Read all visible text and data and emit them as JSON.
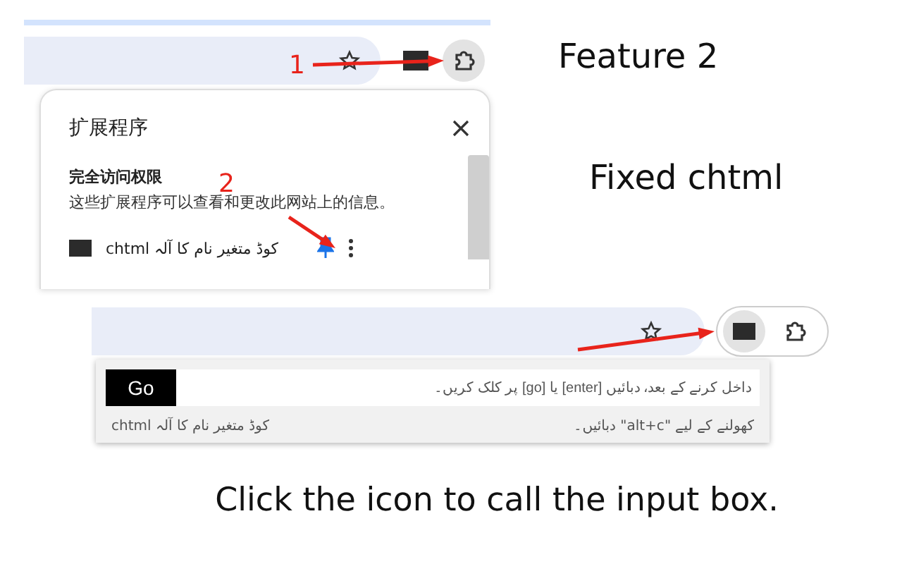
{
  "top_screenshot": {
    "extensions_menu": {
      "title": "扩展程序",
      "section_title": "完全访问权限",
      "section_text": "这些扩展程序可以查看和更改此网站上的信息。",
      "items": [
        {
          "name": "chtml کوڈ متغیر نام کا آلہ",
          "pinned": true
        }
      ]
    }
  },
  "annotations": [
    {
      "label": "1"
    },
    {
      "label": "2"
    }
  ],
  "captions": [
    "Feature 2",
    "Fixed chtml"
  ],
  "bottom_screenshot": {
    "input_popup": {
      "button": "Go",
      "placeholder": "داخل کرنے کے بعد، دبائیں [enter] یا [go] پر کلک کریں۔",
      "title": "chtml کوڈ متغیر نام کا آلہ",
      "hint": "کھولنے کے لیے \"alt+c\" دبائیں۔"
    }
  },
  "footer_caption": "Click the icon to call the input box."
}
